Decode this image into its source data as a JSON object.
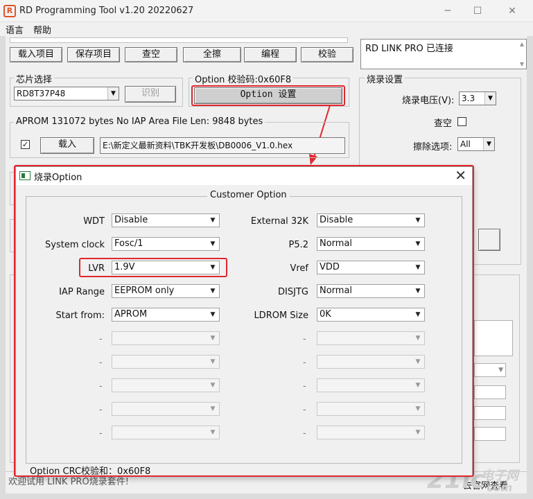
{
  "window": {
    "logo_text": "R",
    "title": "RD Programming Tool v1.20 20220627",
    "controls": {
      "minimize": "─",
      "maximize": "☐",
      "close": "✕"
    }
  },
  "menu": [
    {
      "label": "语言"
    },
    {
      "label": "帮助"
    }
  ],
  "toolbar": [
    {
      "label": "载入项目"
    },
    {
      "label": "保存项目"
    },
    {
      "label": "查空"
    },
    {
      "label": "全擦"
    },
    {
      "label": "编程"
    },
    {
      "label": "校验"
    }
  ],
  "status": {
    "text": "RD LINK PRO 已连接"
  },
  "chip": {
    "group_label": "芯片选择",
    "selected": "RD8T37P48",
    "identify_label": "识别"
  },
  "option_group": {
    "label": "Option  校验码:0x60F8",
    "button": "Option 设置"
  },
  "burn_settings": {
    "label": "烧录设置",
    "voltage_label": "烧录电压(V):",
    "voltage_value": "3.3",
    "blank_check_label": "查空",
    "erase_label": "擦除选项:",
    "erase_value": "All"
  },
  "file_group": {
    "info": "APROM 131072 bytes  No IAP Area    File Len: 9848 bytes",
    "checkbox_mark": "✓",
    "load_label": "载入",
    "path": "E:\\新定义最新资料\\TBK开发板\\DB0006_V1.0.hex"
  },
  "footer_text": "欢迎试用 LINK PRO烧录套件!",
  "footer_right": "去官网查看",
  "watermark": {
    "text": "21ic",
    "suffix": "电子网",
    "domain": "com"
  },
  "dialog": {
    "title": "烧录Option",
    "close": "✕",
    "group_label": "Customer Option",
    "left_options": [
      {
        "label": "WDT",
        "value": "Disable"
      },
      {
        "label": "System clock",
        "value": "Fosc/1"
      },
      {
        "label": "LVR",
        "value": "1.9V"
      },
      {
        "label": "IAP Range",
        "value": "EEPROM only"
      },
      {
        "label": "Start from:",
        "value": "APROM"
      },
      {
        "label": "-",
        "value": ""
      },
      {
        "label": "-",
        "value": ""
      },
      {
        "label": "-",
        "value": ""
      },
      {
        "label": "-",
        "value": ""
      },
      {
        "label": "-",
        "value": ""
      }
    ],
    "right_options": [
      {
        "label": "External 32K",
        "value": "Disable"
      },
      {
        "label": "P5.2",
        "value": "Normal"
      },
      {
        "label": "Vref",
        "value": "VDD"
      },
      {
        "label": "DISJTG",
        "value": "Normal"
      },
      {
        "label": "LDROM Size",
        "value": "0K"
      },
      {
        "label": "-",
        "value": ""
      },
      {
        "label": "-",
        "value": ""
      },
      {
        "label": "-",
        "value": ""
      },
      {
        "label": "-",
        "value": ""
      },
      {
        "label": "-",
        "value": ""
      }
    ],
    "crc_text": "Option CRC校验和：0x60F8"
  },
  "colors": {
    "highlight": "#e0262e",
    "logo": "#e0542a"
  }
}
